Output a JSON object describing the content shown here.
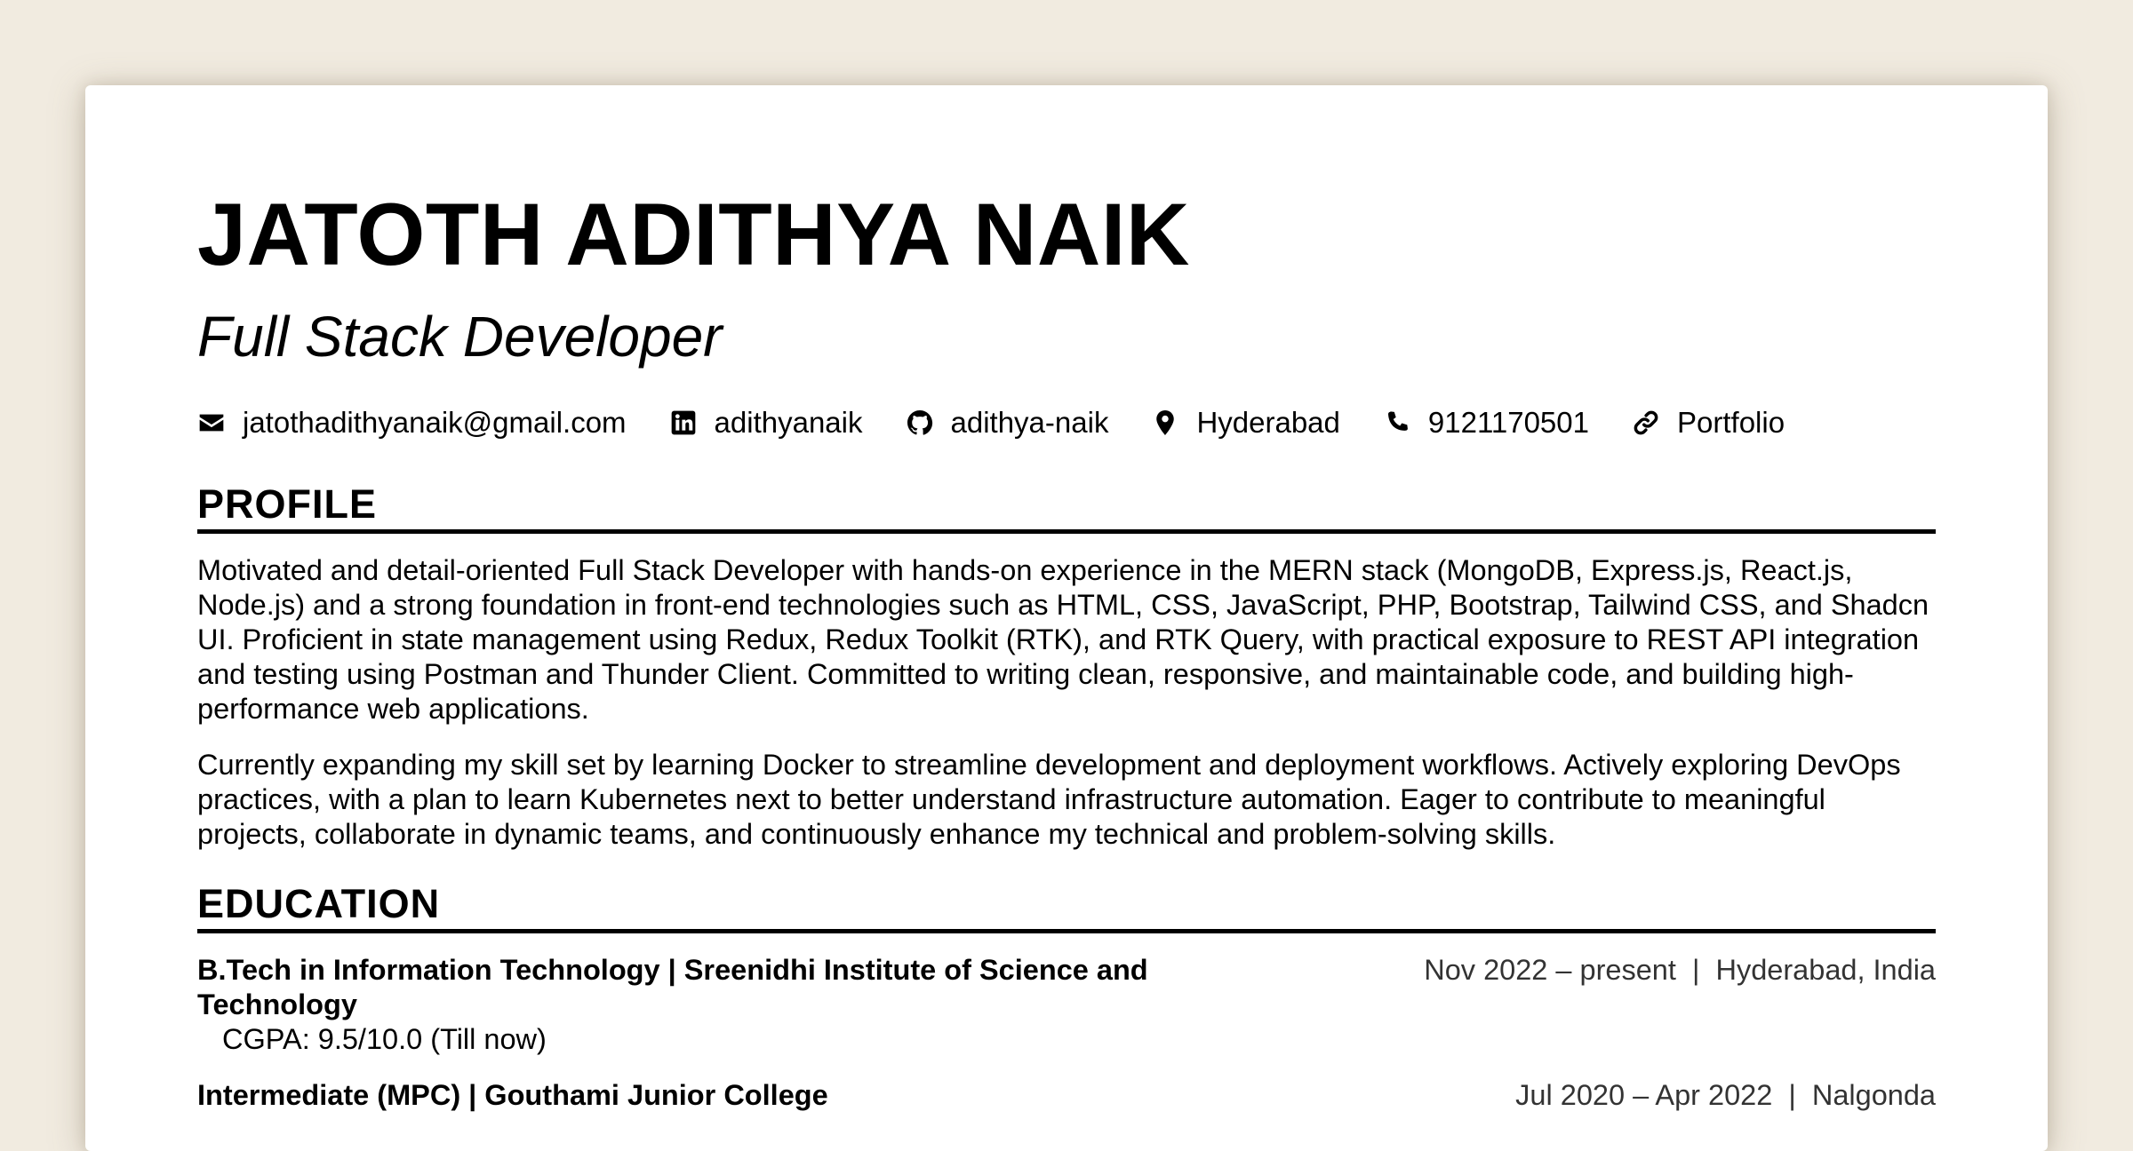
{
  "header": {
    "name": "JATOTH ADITHYA NAIK",
    "role": "Full Stack Developer"
  },
  "contacts": [
    {
      "icon": "envelope-icon",
      "text": "jatothadithyanaik@gmail.com"
    },
    {
      "icon": "linkedin-icon",
      "text": "adithyanaik"
    },
    {
      "icon": "github-icon",
      "text": "adithya-naik"
    },
    {
      "icon": "location-pin-icon",
      "text": "Hyderabad"
    },
    {
      "icon": "phone-icon",
      "text": "9121170501"
    },
    {
      "icon": "link-icon",
      "text": "Portfolio"
    }
  ],
  "profile": {
    "title": "PROFILE",
    "paragraphs": [
      "Motivated and detail-oriented Full Stack Developer with hands-on experience in the MERN stack (MongoDB, Express.js, React.js, Node.js) and a strong foundation in front-end technologies such as HTML, CSS, JavaScript, PHP, Bootstrap, Tailwind CSS, and Shadcn UI. Proficient in state management using Redux, Redux Toolkit (RTK), and RTK Query, with practical exposure to REST API integration and testing using Postman and Thunder Client. Committed to writing clean, responsive, and maintainable code, and building high-performance web applications.",
      "Currently expanding my skill set by learning Docker to streamline development and deployment workflows. Actively exploring DevOps practices, with a plan to learn Kubernetes next to better understand infrastructure automation. Eager to contribute to meaningful projects, collaborate in dynamic teams, and continuously enhance my technical and problem-solving skills."
    ]
  },
  "education": {
    "title": "EDUCATION",
    "items": [
      {
        "title": "B.Tech in Information Technology | Sreenidhi Institute of Science and Technology",
        "meta": "Nov 2022 – present  |  Hyderabad, India",
        "detail": "CGPA: 9.5/10.0 (Till now)"
      },
      {
        "title": "Intermediate (MPC) | Gouthami Junior College",
        "meta": "Jul 2020 – Apr 2022  |  Nalgonda"
      }
    ]
  },
  "colors": {
    "background": "#f1ebe0",
    "paper": "#ffffff",
    "text": "#000000",
    "meta_text": "#333333"
  }
}
